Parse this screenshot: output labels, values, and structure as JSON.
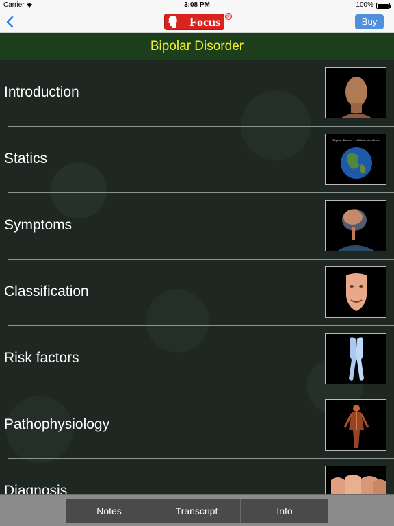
{
  "status_bar": {
    "carrier": "Carrier",
    "time": "3:08 PM",
    "battery": "100%"
  },
  "nav": {
    "logo_text": "Focus",
    "logo_mark": "®",
    "buy_label": "Buy"
  },
  "banner": {
    "title": "Bipolar Disorder"
  },
  "topics": [
    {
      "label": "Introduction"
    },
    {
      "label": "Statics",
      "thumb_caption": "Bipolar disorder - Lifetime prevalence"
    },
    {
      "label": "Symptoms"
    },
    {
      "label": "Classification"
    },
    {
      "label": "Risk factors"
    },
    {
      "label": "Pathophysiology"
    },
    {
      "label": "Diagnosis"
    }
  ],
  "bottom_tabs": [
    {
      "label": "Notes"
    },
    {
      "label": "Transcript"
    },
    {
      "label": "Info"
    }
  ],
  "colors": {
    "banner_bg": "#1c3e1b",
    "banner_text": "#f0f02a",
    "buy_bg": "#4f8fde",
    "logo_red": "#d9231e"
  },
  "icons": [
    "wifi-icon",
    "battery-icon",
    "back-chevron-icon",
    "focus-logo-head-icon"
  ]
}
